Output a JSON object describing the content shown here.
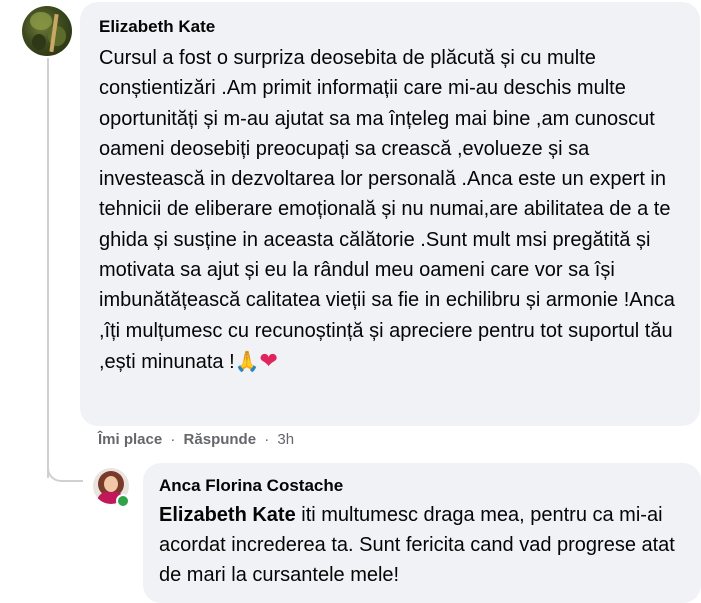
{
  "comment": {
    "author": "Elizabeth Kate",
    "text": "Cursul a fost o surpriza deosebita de plăcută și cu multe conștientizări .Am primit informații care mi-au deschis multe oportunități și m-au ajutat sa ma înțeleg mai bine ,am cunoscut oameni deosebiți preocupați sa crească ,evolueze și sa investească in dezvoltarea lor personală .Anca este un expert in tehnicii de eliberare emoțională și nu numai,are abilitatea de a te ghida și susține in aceasta călătorie .Sunt mult msi pregătită și motivata sa ajut și eu la rândul meu oameni care vor sa își imbunătățească calitatea vieții sa fie in echilibru și armonie !Anca ,îți mulțumesc cu recunoștință și apreciere pentru tot suportul tău ,ești minunata !",
    "emoji_pray": "🙏",
    "emoji_heart": "❤",
    "actions": {
      "like": "Îmi place",
      "separator": "·",
      "reply": "Răspunde",
      "time": "3h"
    }
  },
  "reply": {
    "author": "Anca Florina Costache",
    "mention": "Elizabeth Kate",
    "text": " iti multumesc draga mea, pentru ca mi-ai acordat increderea ta. Sunt fericita cand vad progrese atat de mari la cursantele mele!",
    "online_color": "#31a24c"
  }
}
